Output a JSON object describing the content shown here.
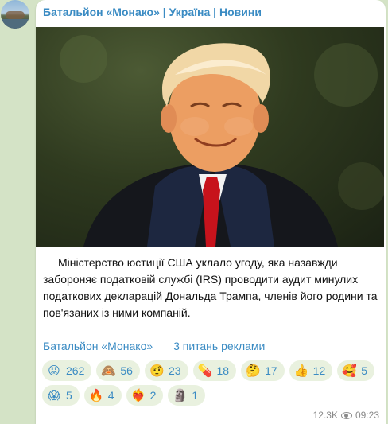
{
  "channel": {
    "name": "Батальйон «Монако» | Україна | Новини"
  },
  "photo": {
    "icon": "portrait-photo"
  },
  "post": {
    "text": "Міністерство юстиції США уклало угоду, яка назавжди забороняє податковій службі (IRS) проводити аудит минулих податкових декларацій Дональда Трампа, членів його родини та пов'язаних із ними компаній."
  },
  "links": {
    "channel_link": "Батальйон «Монако»",
    "ad_link": "3 питань реклами"
  },
  "reactions": [
    {
      "emoji": "😡",
      "icon": "angry-face-icon",
      "count": "262"
    },
    {
      "emoji": "🙈",
      "icon": "see-no-evil-monkey-icon",
      "count": "56"
    },
    {
      "emoji": "🤨",
      "icon": "raised-eyebrow-face-icon",
      "count": "23"
    },
    {
      "emoji": "💊",
      "icon": "pill-icon",
      "count": "18"
    },
    {
      "emoji": "🤔",
      "icon": "thinking-face-icon",
      "count": "17"
    },
    {
      "emoji": "👍",
      "icon": "thumbs-up-icon",
      "count": "12"
    },
    {
      "emoji": "🥰",
      "icon": "smiling-hearts-face-icon",
      "count": "5"
    },
    {
      "emoji": "😱",
      "icon": "screaming-face-icon",
      "count": "5"
    },
    {
      "emoji": "🔥",
      "icon": "fire-icon",
      "count": "4"
    },
    {
      "emoji": "❤️‍🔥",
      "icon": "heart-on-fire-icon",
      "count": "2"
    },
    {
      "emoji": "🗿",
      "icon": "moai-icon",
      "count": "1"
    }
  ],
  "footer": {
    "views": "12.3K",
    "time": "09:23"
  }
}
